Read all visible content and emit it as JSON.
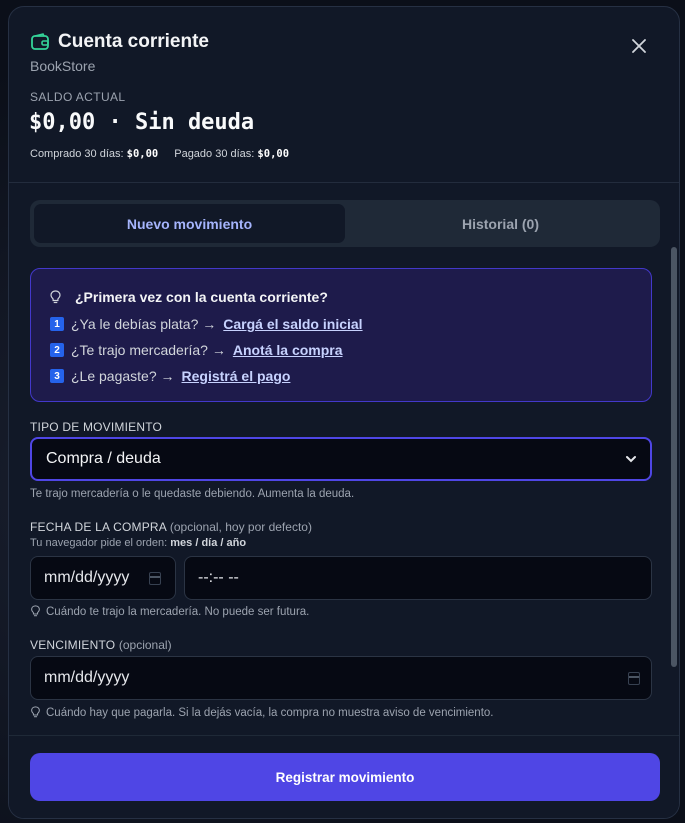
{
  "header": {
    "title": "Cuenta corriente",
    "subtitle": "BookStore",
    "balance_label": "SALDO ACTUAL",
    "balance_value": "$0,00 · Sin deuda",
    "bought_label": "Comprado 30 días:",
    "bought_value": "$0,00",
    "paid_label": "Pagado 30 días:",
    "paid_value": "$0,00"
  },
  "tabs": [
    {
      "label": "Nuevo movimiento",
      "active": true
    },
    {
      "label": "Historial (0)",
      "active": false
    }
  ],
  "tips": {
    "title": "¿Primera vez con la cuenta corriente?",
    "items": [
      {
        "num": "1",
        "text": "¿Ya le debías plata? →",
        "link": "Cargá el saldo inicial"
      },
      {
        "num": "2",
        "text": "¿Te trajo mercadería? →",
        "link": "Anotá la compra"
      },
      {
        "num": "3",
        "text": "¿Le pagaste? →",
        "link": "Registrá el pago"
      }
    ]
  },
  "form": {
    "type_label": "TIPO DE MOVIMIENTO",
    "type_value": "Compra / deuda",
    "type_hint": "Te trajo mercadería o le quedaste debiendo. Aumenta la deuda.",
    "date_label": "FECHA DE LA COMPRA",
    "date_label_opt": "(opcional, hoy por defecto)",
    "date_order_hint": "Tu navegador pide el orden:",
    "date_order_value": "mes / día / año",
    "date_placeholder": "mm/dd/yyyy",
    "time_placeholder": "--:-- --",
    "date_hint": "Cuándo te trajo la mercadería. No puede ser futura.",
    "due_label": "VENCIMIENTO",
    "due_label_opt": "(opcional)",
    "due_placeholder": "mm/dd/yyyy",
    "due_hint": "Cuándo hay que pagarla. Si la dejás vacía, la compra no muestra aviso de vencimiento."
  },
  "footer": {
    "submit_label": "Registrar movimiento"
  },
  "colors": {
    "accent": "#4f46e5",
    "wallet_icon": "#34d399",
    "tips_bg": "#1e1b4b"
  }
}
